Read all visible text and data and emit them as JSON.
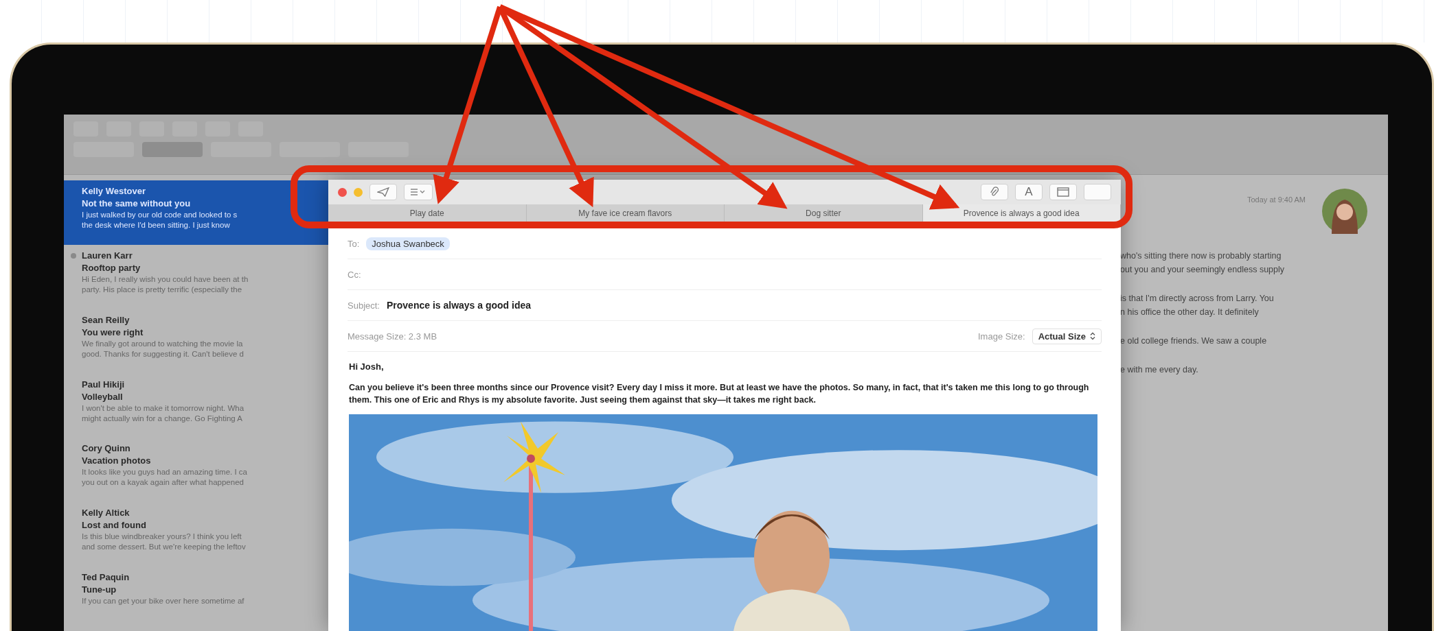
{
  "mail_list": [
    {
      "sender": "Kelly Westover",
      "subject": "Not the same without you",
      "preview": [
        "I just walked by our old code and looked to s",
        "the desk where I'd been sitting. I just know"
      ],
      "selected": true,
      "flagged": false
    },
    {
      "sender": "Lauren Karr",
      "subject": "Rooftop party",
      "preview": [
        "Hi Eden, I really wish you could have been at th",
        "party. His place is pretty terrific (especially the"
      ],
      "selected": false,
      "flagged": true
    },
    {
      "sender": "Sean Reilly",
      "subject": "You were right",
      "preview": [
        "We finally got around to watching the movie la",
        "good. Thanks for suggesting it. Can't believe d"
      ],
      "selected": false,
      "flagged": false
    },
    {
      "sender": "Paul Hikiji",
      "subject": "Volleyball",
      "preview": [
        "I won't be able to make it tomorrow night. Wha",
        "might actually win for a change. Go Fighting A"
      ],
      "selected": false,
      "flagged": false
    },
    {
      "sender": "Cory Quinn",
      "subject": "Vacation photos",
      "preview": [
        "It looks like you guys had an amazing time. I ca",
        "you out on a kayak again after what happened"
      ],
      "selected": false,
      "flagged": false
    },
    {
      "sender": "Kelly Altick",
      "subject": "Lost and found",
      "preview": [
        "Is this blue windbreaker yours? I think you left",
        "and some dessert. But we're keeping the leftov"
      ],
      "selected": false,
      "flagged": false
    },
    {
      "sender": "Ted Paquin",
      "subject": "Tune-up",
      "preview": [
        "If you can get your bike over here sometime af"
      ],
      "selected": false,
      "flagged": false
    }
  ],
  "reading_pane": {
    "date": "Today at 9:40 AM",
    "paragraphs": [
      [
        "who's sitting there now is probably starting",
        "out you and your seemingly endless supply"
      ],
      [
        "is that I'm directly across from Larry. You",
        "n his office the other day. It definitely"
      ],
      [
        "e old college friends. We saw a couple"
      ],
      [
        "e with me every day."
      ]
    ]
  },
  "compose": {
    "font_button": "A",
    "tabs": [
      {
        "label": "Play date",
        "selected": false
      },
      {
        "label": "My fave ice cream flavors",
        "selected": false
      },
      {
        "label": "Dog sitter",
        "selected": false
      },
      {
        "label": "Provence is always a good idea",
        "selected": true
      }
    ],
    "to_label": "To:",
    "to_recipient": "Joshua Swanbeck",
    "cc_label": "Cc:",
    "subject_label": "Subject:",
    "subject": "Provence is always a good idea",
    "message_size": "Message Size: 2.3 MB",
    "image_size_label": "Image Size:",
    "image_size": "Actual Size",
    "greeting": "Hi Josh,",
    "body": "Can you believe it's been three months since our Provence visit? Every day I miss it more. But at least we have the photos. So many, in fact, that it's taken me this long to go through them. This one of Eric and Rhys is my absolute favorite. Just seeing them against that sky—it takes me right back."
  }
}
